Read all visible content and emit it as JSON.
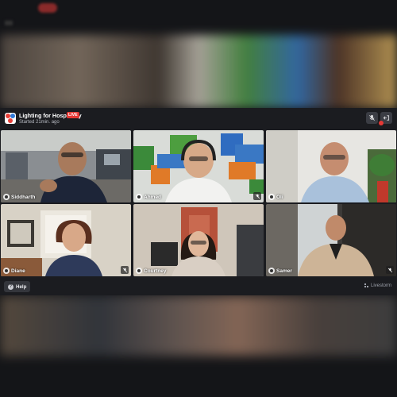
{
  "meeting": {
    "title": "Lighting for Hospitality",
    "live_badge": "LIVE",
    "started": "Started 21min. ago"
  },
  "header_buttons": {
    "mute_icon": "mic-off-icon",
    "leave_icon": "leave-icon"
  },
  "participants": [
    {
      "name": "Siddharth",
      "muted": false
    },
    {
      "name": "Ahmed",
      "muted": true
    },
    {
      "name": "Oli",
      "muted": false
    },
    {
      "name": "Diane",
      "muted": true
    },
    {
      "name": "Courtney",
      "muted": false
    },
    {
      "name": "Samer",
      "muted": true
    }
  ],
  "footer": {
    "help_label": "Help",
    "brand_label": "Livestorm"
  },
  "colors": {
    "live": "#e53935",
    "panel_bg": "#1b1c20",
    "page_bg": "#141518"
  }
}
